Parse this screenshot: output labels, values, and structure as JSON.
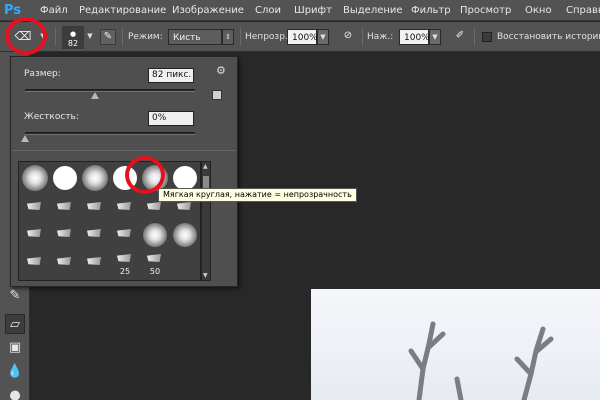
{
  "app": {
    "logo": "Ps"
  },
  "menu": [
    "Файл",
    "Редактирование",
    "Изображение",
    "Слои",
    "Шрифт",
    "Выделение",
    "Фильтр",
    "Просмотр",
    "Окно",
    "Справка"
  ],
  "options": {
    "brush_size": "82",
    "mode_label": "Режим:",
    "mode_value": "Кисть",
    "opacity_label": "Непрозр.:",
    "opacity_value": "100%",
    "flow_label": "Наж.:",
    "flow_value": "100%",
    "restore_history_label": "Восстановить историю"
  },
  "panel": {
    "size_label": "Размер:",
    "size_value": "82 пикс.",
    "size_slider_fraction": 0.41,
    "hardness_label": "Жесткость:",
    "hardness_value": "0%",
    "hardness_slider_fraction": 0.0,
    "brush_numbers": [
      "25",
      "50"
    ]
  },
  "tooltip": "Мягкая круглая, нажатие = непрозрачность",
  "colors": {
    "highlight_ring": "#e8101c",
    "tooltip_bg": "#ffffe1",
    "ps_blue": "#31a8ff"
  }
}
